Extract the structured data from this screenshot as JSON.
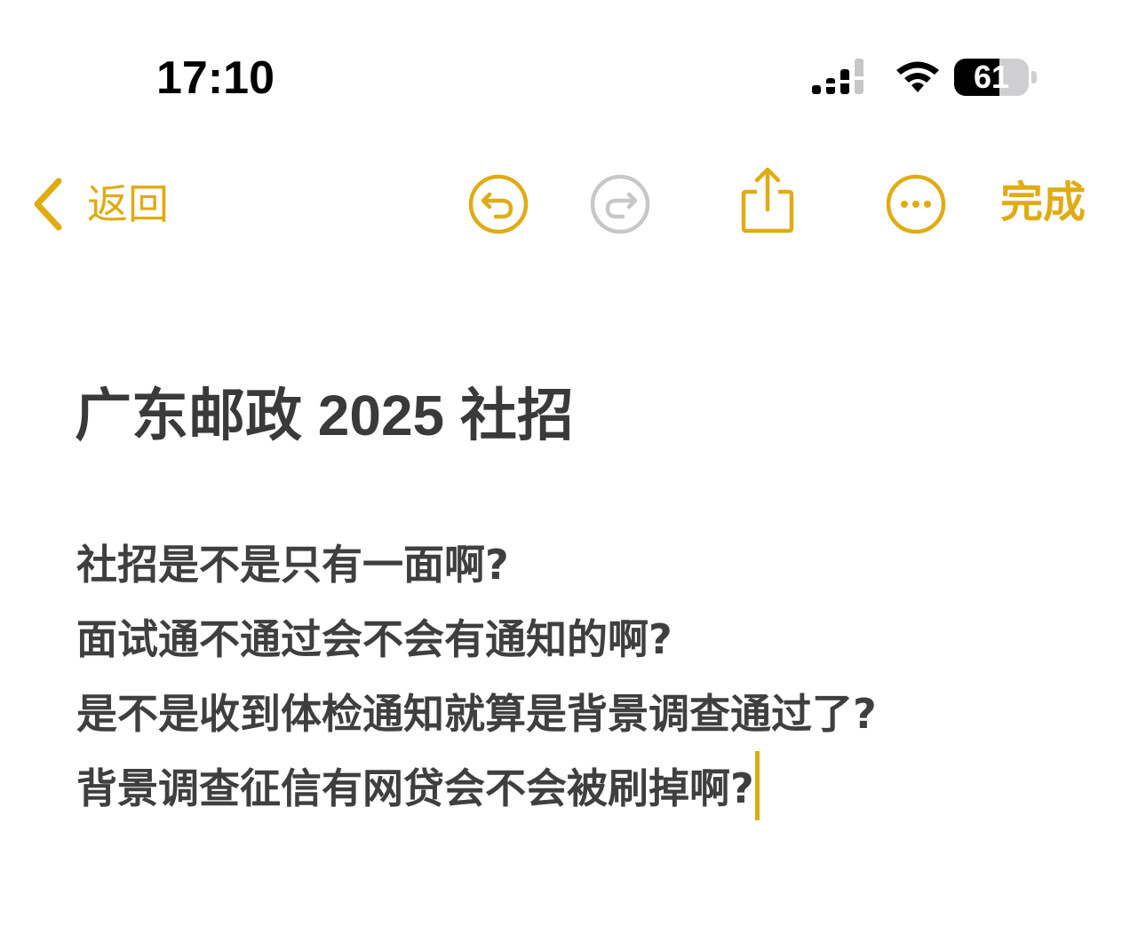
{
  "status_bar": {
    "time": "17:10",
    "battery_level": "61",
    "battery_fraction": 0.61,
    "cellular_icon": "cellular-signal-icon",
    "wifi_icon": "wifi-icon"
  },
  "toolbar": {
    "back_label": "返回",
    "done_label": "完成",
    "icons": [
      "undo-icon",
      "redo-icon",
      "share-icon",
      "more-icon"
    ],
    "accent_color": "#e1ab13",
    "disabled_color": "#c7c7c7"
  },
  "note": {
    "title": "广东邮政 2025 社招",
    "lines": [
      "社招是不是只有一面啊?",
      "面试通不通过会不会有通知的啊?",
      "是不是收到体检通知就算是背景调查通过了?",
      "背景调查征信有网贷会不会被刷掉啊?"
    ]
  }
}
